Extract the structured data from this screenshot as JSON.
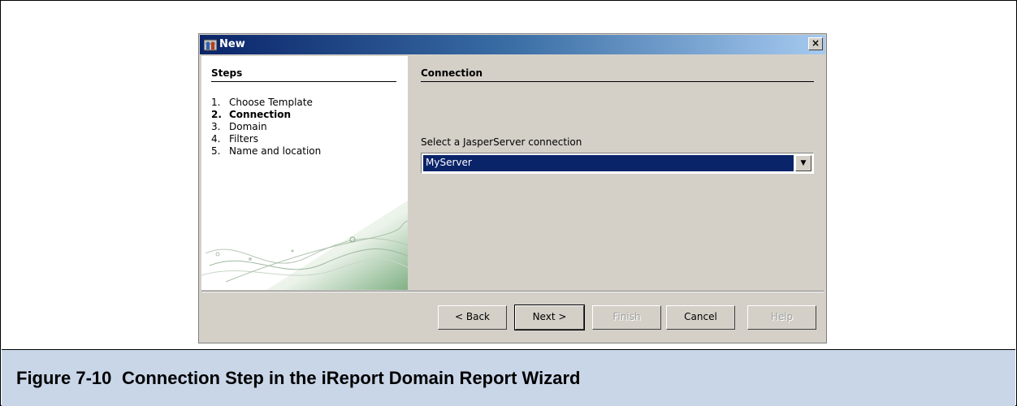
{
  "dialog": {
    "title": "New",
    "close_label": "×"
  },
  "steps": {
    "heading": "Steps",
    "items": [
      {
        "num": "1.",
        "label": "Choose Template"
      },
      {
        "num": "2.",
        "label": "Connection"
      },
      {
        "num": "3.",
        "label": "Domain"
      },
      {
        "num": "4.",
        "label": "Filters"
      },
      {
        "num": "5.",
        "label": "Name and location"
      }
    ],
    "active_index": 1
  },
  "panel": {
    "heading": "Connection",
    "connection_label": "Select a JasperServer connection",
    "connection_value": "MyServer"
  },
  "buttons": {
    "back": "< Back",
    "next": "Next >",
    "finish": "Finish",
    "cancel": "Cancel",
    "help": "Help"
  },
  "caption": {
    "number": "Figure 7-10",
    "text": "Connection Step in the iReport Domain Report Wizard"
  },
  "colors": {
    "title_bar": "#0a246a",
    "selection": "#0a246a",
    "dialog_bg": "#d4d0c8",
    "caption_bg": "#c9d6e8"
  }
}
